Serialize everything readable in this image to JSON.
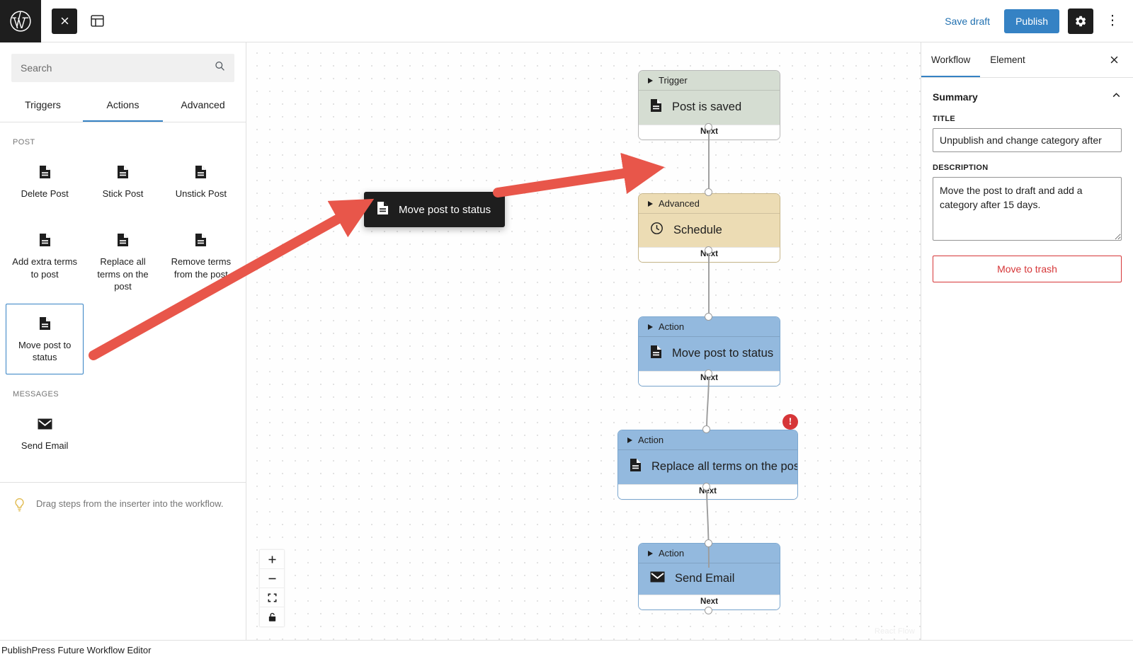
{
  "app": {
    "status_text": "PublishPress Future Workflow Editor"
  },
  "topbar": {
    "wp_logo": "wordpress-logo",
    "close_label": "×",
    "toggle_inserter_label": "layout-toggle",
    "save_draft_label": "Save draft",
    "publish_label": "Publish",
    "settings_label": "settings-gear",
    "more_label": "⋮"
  },
  "inserter": {
    "search": {
      "placeholder": "Search",
      "value": ""
    },
    "tabs": [
      {
        "label": "Triggers",
        "active": false
      },
      {
        "label": "Actions",
        "active": true
      },
      {
        "label": "Advanced",
        "active": false
      }
    ],
    "groups": [
      {
        "label": "POST",
        "items": [
          {
            "label": "Delete Post",
            "icon": "post-icon",
            "selected": false
          },
          {
            "label": "Stick Post",
            "icon": "post-icon",
            "selected": false
          },
          {
            "label": "Unstick Post",
            "icon": "post-icon",
            "selected": false
          },
          {
            "label": "Add extra terms to post",
            "icon": "post-icon",
            "selected": false
          },
          {
            "label": "Replace all terms on the post",
            "icon": "post-icon",
            "selected": false
          },
          {
            "label": "Remove terms from the post",
            "icon": "post-icon",
            "selected": false
          },
          {
            "label": "Move post to status",
            "icon": "post-icon",
            "selected": true
          }
        ]
      },
      {
        "label": "MESSAGES",
        "items": [
          {
            "label": "Send Email",
            "icon": "email-icon",
            "selected": false
          }
        ]
      }
    ],
    "tip": "Drag steps from the inserter into the workflow."
  },
  "drag_ghost": {
    "label": "Move post to status",
    "icon": "post-icon"
  },
  "canvas": {
    "attribution": "React Flow",
    "next_label": "Next",
    "controls": [
      {
        "name": "zoom-in",
        "glyph": "+"
      },
      {
        "name": "zoom-out",
        "glyph": "−"
      },
      {
        "name": "fit-view",
        "glyph": "fit"
      },
      {
        "name": "toggle-interactivity",
        "glyph": "unlock"
      }
    ],
    "nodes": [
      {
        "type": "Trigger",
        "kind": "trigger",
        "label": "Post is saved",
        "icon": "post-icon",
        "error": false
      },
      {
        "type": "Advanced",
        "kind": "advanced",
        "label": "Schedule",
        "icon": "clock-icon",
        "error": false
      },
      {
        "type": "Action",
        "kind": "action",
        "label": "Move post to status",
        "icon": "post-icon",
        "error": false
      },
      {
        "type": "Action",
        "kind": "action",
        "label": "Replace all terms on the post",
        "icon": "post-icon",
        "error": true
      },
      {
        "type": "Action",
        "kind": "action",
        "label": "Send Email",
        "icon": "email-icon",
        "error": false
      }
    ]
  },
  "settings": {
    "tabs": [
      {
        "label": "Workflow",
        "active": true
      },
      {
        "label": "Element",
        "active": false
      }
    ],
    "close_label": "✕",
    "summary": {
      "title": "Summary",
      "title_field_label": "TITLE",
      "title_value": "Unpublish and change category after ",
      "description_field_label": "DESCRIPTION",
      "description_value": "Move the post to draft and add a category after 15 days.",
      "trash_label": "Move to trash"
    }
  },
  "colors": {
    "accent": "#3582c4",
    "link": "#2271b1",
    "danger": "#d63638",
    "trigger_node": "#d5ddd2",
    "advanced_node": "#ecdcb4",
    "action_node": "#93b9de",
    "annotation_arrow": "#e8564a"
  }
}
